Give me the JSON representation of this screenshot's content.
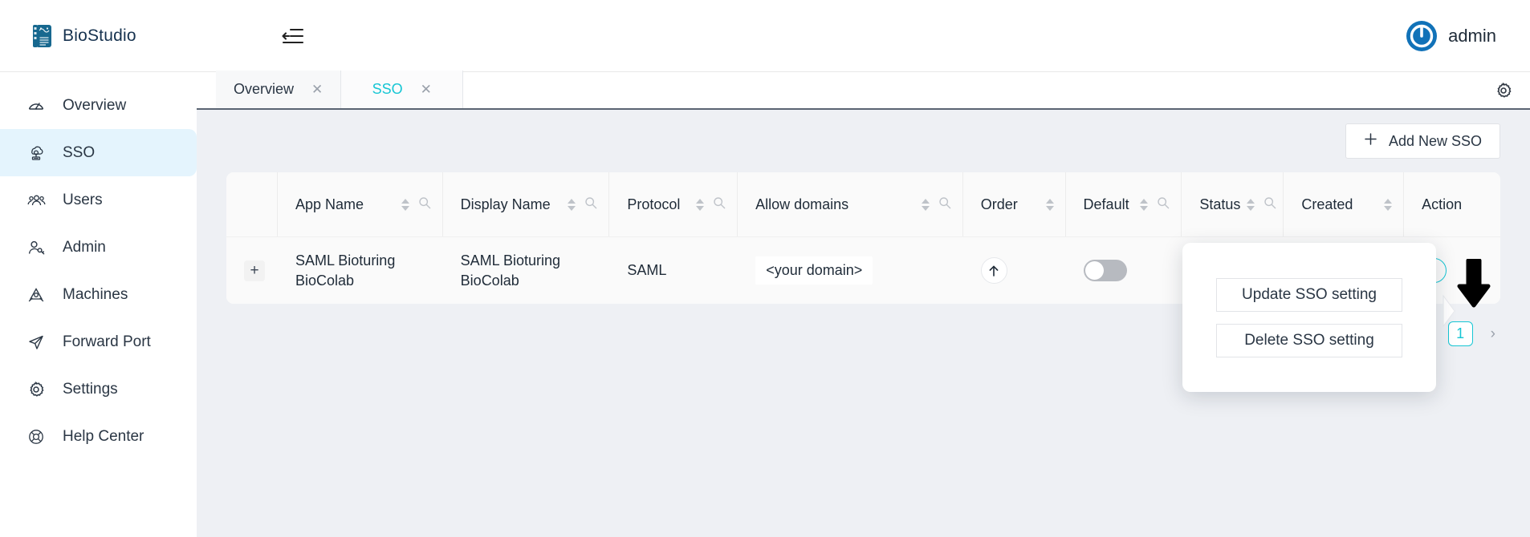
{
  "brand": {
    "name": "BioStudio",
    "logo_icon": "notebook-icon"
  },
  "topbar": {
    "collapse_icon": "collapse-sidebar-icon",
    "user": {
      "name": "admin",
      "avatar_icon": "power-avatar-icon"
    }
  },
  "sidebar": {
    "items": [
      {
        "label": "Overview",
        "icon": "dashboard-icon",
        "active": false
      },
      {
        "label": "SSO",
        "icon": "sso-cloud-icon",
        "active": true
      },
      {
        "label": "Users",
        "icon": "users-icon",
        "active": false
      },
      {
        "label": "Admin",
        "icon": "admin-key-icon",
        "active": false
      },
      {
        "label": "Machines",
        "icon": "machines-icon",
        "active": false
      },
      {
        "label": "Forward Port",
        "icon": "send-icon",
        "active": false
      },
      {
        "label": "Settings",
        "icon": "gear-icon",
        "active": false
      },
      {
        "label": "Help Center",
        "icon": "lifebuoy-icon",
        "active": false
      }
    ]
  },
  "tabs": {
    "items": [
      {
        "label": "Overview",
        "active": false,
        "close_icon": "close-icon"
      },
      {
        "label": "SSO",
        "active": true,
        "close_icon": "close-icon"
      }
    ],
    "settings_icon": "gear-icon"
  },
  "toolbar": {
    "add_label": "Add New SSO",
    "add_icon": "plus-icon"
  },
  "table": {
    "columns": [
      {
        "label": "App Name",
        "sortable": true,
        "searchable": true
      },
      {
        "label": "Display Name",
        "sortable": true,
        "searchable": true
      },
      {
        "label": "Protocol",
        "sortable": true,
        "searchable": true
      },
      {
        "label": "Allow domains",
        "sortable": true,
        "searchable": true
      },
      {
        "label": "Order",
        "sortable": true,
        "searchable": false
      },
      {
        "label": "Default",
        "sortable": true,
        "searchable": true
      },
      {
        "label": "Status",
        "sortable": true,
        "searchable": true
      },
      {
        "label": "Created",
        "sortable": true,
        "searchable": false
      },
      {
        "label": "Action",
        "sortable": false,
        "searchable": false
      }
    ],
    "rows": [
      {
        "expand_icon": "plus-icon",
        "app_name": "SAML Bioturing BioColab",
        "display_name": "SAML Bioturing BioColab",
        "protocol": "SAML",
        "allow_domains": "<your domain>",
        "order_icon": "arrow-up-icon",
        "default_on": false,
        "status": "",
        "created": "",
        "action_icon": "more-vertical-icon"
      }
    ]
  },
  "popup": {
    "visible": true,
    "buttons": [
      {
        "label": "Update SSO setting"
      },
      {
        "label": "Delete SSO setting"
      }
    ]
  },
  "pagination": {
    "prev_icon": "chevron-left-icon",
    "next_icon": "chevron-right-icon",
    "current_page": "1"
  },
  "annotation": {
    "cursor_icon": "down-arrow-pointer"
  },
  "colors": {
    "accent_teal": "#16c6d4",
    "brand_blue": "#17688f",
    "sidebar_active_bg": "#e4f4fd",
    "content_bg": "#eef0f4",
    "card_bg": "#fafafa"
  }
}
